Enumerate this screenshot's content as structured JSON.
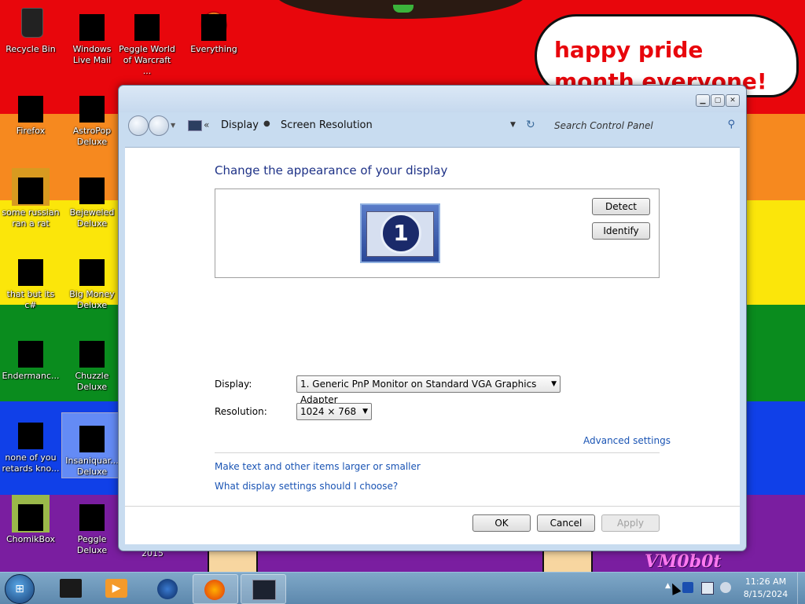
{
  "desktop": {
    "speech_bubble": "happy pride month everyone!",
    "watermark": "VM0b0t",
    "icons": [
      {
        "label": "Recycle Bin",
        "icon": "recycle-bin-icon"
      },
      {
        "label": "Windows Live Mail",
        "icon": "mail-icon"
      },
      {
        "label": "Peggle World of Warcraft ...",
        "icon": "peggle-icon"
      },
      {
        "label": "Everything",
        "icon": "everything-icon"
      },
      {
        "label": "Firefox",
        "icon": "firefox-icon"
      },
      {
        "label": "AstroPop Deluxe",
        "icon": "astropop-icon"
      },
      {
        "label": "some russian ran a rat",
        "icon": "app-icon"
      },
      {
        "label": "Bejeweled Deluxe",
        "icon": "bejeweled-icon"
      },
      {
        "label": "that but its c#",
        "icon": "app-icon"
      },
      {
        "label": "Big Money Deluxe",
        "icon": "bigmoney-icon"
      },
      {
        "label": "Endermanc...",
        "icon": "app-icon"
      },
      {
        "label": "Chuzzle Deluxe",
        "icon": "chuzzle-icon"
      },
      {
        "label": "none of you retards kno...",
        "icon": "app-icon"
      },
      {
        "label": "Insaniquar... Deluxe",
        "icon": "insaniquarium-icon"
      },
      {
        "label": "ChomikBox",
        "icon": "chomikbox-icon"
      },
      {
        "label": "Peggle Deluxe",
        "icon": "peggle-icon"
      }
    ],
    "partial_label": "2015"
  },
  "window": {
    "breadcrumb": [
      "Display",
      "Screen Resolution"
    ],
    "search_placeholder": "Search Control Panel",
    "title": "Change the appearance of your display",
    "monitor_number": "1",
    "detect_label": "Detect",
    "identify_label": "Identify",
    "display_label": "Display:",
    "display_value": "1. Generic PnP Monitor on Standard VGA Graphics Adapter",
    "resolution_label": "Resolution:",
    "resolution_value": "1024 × 768",
    "advanced_link": "Advanced settings",
    "link_text_size": "Make text and other items larger or smaller",
    "link_help": "What display settings should I choose?",
    "ok_label": "OK",
    "cancel_label": "Cancel",
    "apply_label": "Apply"
  },
  "taskbar": {
    "time": "11:26 AM",
    "date": "8/15/2024",
    "items": [
      "explorer-icon",
      "media-player-icon",
      "globe-icon",
      "firefox-icon",
      "display-settings-icon"
    ]
  },
  "colors": {
    "link": "#1a54b4",
    "title": "#1e3287"
  }
}
